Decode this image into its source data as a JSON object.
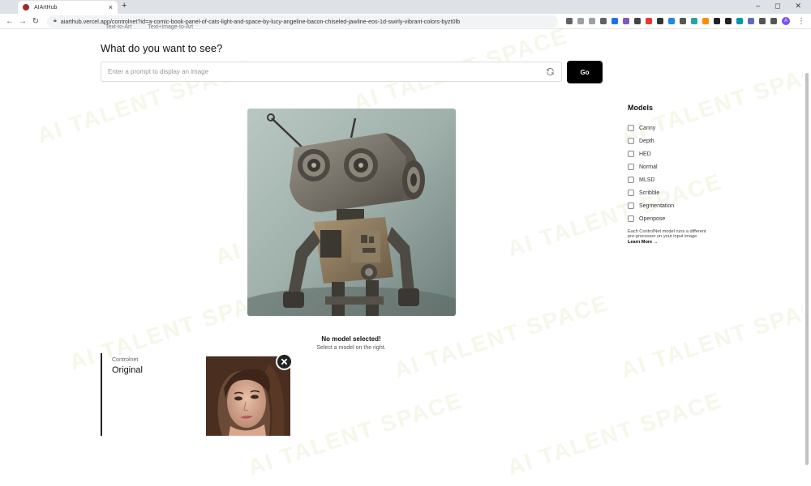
{
  "browser": {
    "tab_title": "AIArtHub",
    "tab_close": "×",
    "new_tab": "+",
    "url": "aiarthub.vercel.app/controlnet?id=a-comic-book-panel-of-cats-light-and-space-by-lucy-angeline-bacon-chiseled-jawline-eos-1d-swirly-vibrant-colors-byzt0lb",
    "avatar": "A",
    "controls": [
      "–",
      "◻",
      "✕"
    ]
  },
  "nav": {
    "tabs": [
      "Text-to-Art",
      "Text+Image-to-Art"
    ]
  },
  "main": {
    "heading": "What do you want to see?",
    "prompt_placeholder": "Enter a prompt to display an image",
    "go_label": "Go"
  },
  "status": {
    "title": "No model selected!",
    "subtitle": "Select a model on the right."
  },
  "controlnet": {
    "label": "Controlnet",
    "title": "Original"
  },
  "models": {
    "title": "Models",
    "items": [
      {
        "label": "Canny"
      },
      {
        "label": "Depth"
      },
      {
        "label": "HED"
      },
      {
        "label": "Normal"
      },
      {
        "label": "MLSD"
      },
      {
        "label": "Scribble"
      },
      {
        "label": "Segmentation"
      },
      {
        "label": "Openpose"
      }
    ],
    "note": "Each ControlNet model runs a different pre-processor on your input image.",
    "learn_more": "Learn More →"
  },
  "watermark": {
    "text": "AI TALENT SPACE"
  },
  "icons": {
    "refresh": "refresh-icon",
    "close": "close-icon",
    "lock": "lock-icon"
  }
}
